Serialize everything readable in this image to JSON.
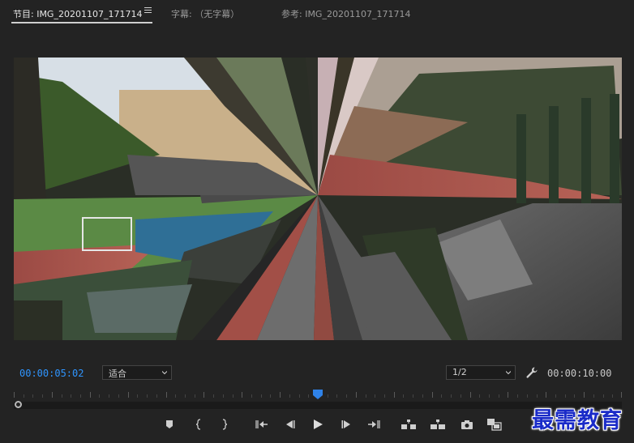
{
  "tabs": [
    {
      "label": "节目: IMG_20201107_171714",
      "active": true
    },
    {
      "label": "字幕: （无字幕）",
      "active": false
    },
    {
      "label": "参考: IMG_20201107_171714",
      "active": false
    }
  ],
  "player": {
    "current_timecode": "00:00:05:02",
    "duration_timecode": "00:00:10:00",
    "fit_select": "适合",
    "resolution_select": "1/2",
    "playhead_fraction": 0.5
  },
  "controls": [
    {
      "name": "add-marker-icon"
    },
    {
      "name": "mark-in-icon"
    },
    {
      "name": "mark-out-icon"
    },
    {
      "name": "go-to-in-icon"
    },
    {
      "name": "step-back-icon"
    },
    {
      "name": "play-icon"
    },
    {
      "name": "step-forward-icon"
    },
    {
      "name": "go-to-out-icon"
    },
    {
      "name": "lift-icon"
    },
    {
      "name": "extract-icon"
    },
    {
      "name": "export-frame-icon"
    },
    {
      "name": "comparison-view-icon"
    }
  ],
  "watermark": "最需教育",
  "colors": {
    "timecode_accent": "#2f95ff",
    "background": "#232323",
    "watermark": "#1a2bc8"
  }
}
